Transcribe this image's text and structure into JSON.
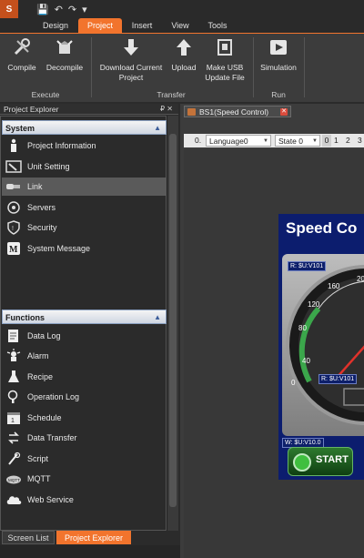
{
  "app": {
    "icon_letter": "S"
  },
  "quick_access": {
    "save": "💾",
    "undo": "↶",
    "redo": "↷",
    "more": "▾"
  },
  "ribbon_tabs": [
    {
      "label": "Design"
    },
    {
      "label": "Project"
    },
    {
      "label": "Insert"
    },
    {
      "label": "View"
    },
    {
      "label": "Tools"
    }
  ],
  "ribbon": {
    "compile": "Compile",
    "decompile": "Decompile",
    "group_execute": "Execute",
    "download_line1": "Download Current",
    "download_line2": "Project",
    "upload": "Upload",
    "make_usb_line1": "Make USB",
    "make_usb_line2": "Update File",
    "group_transfer": "Transfer",
    "simulation": "Simulation",
    "group_run": "Run"
  },
  "project_explorer": {
    "title": "Project Explorer",
    "pin": "₽ ✕",
    "system_header": "System",
    "system_items": [
      {
        "label": "Project Information"
      },
      {
        "label": "Unit Setting"
      },
      {
        "label": "Link"
      },
      {
        "label": "Servers"
      },
      {
        "label": "Security"
      },
      {
        "label": "System Message"
      }
    ],
    "functions_header": "Functions",
    "functions_items": [
      {
        "label": "Data Log"
      },
      {
        "label": "Alarm"
      },
      {
        "label": "Recipe"
      },
      {
        "label": "Operation Log"
      },
      {
        "label": "Schedule"
      },
      {
        "label": "Data Transfer"
      },
      {
        "label": "Script"
      },
      {
        "label": "MQTT"
      },
      {
        "label": "Web Service"
      }
    ]
  },
  "bottom_tabs": [
    {
      "label": "Screen List"
    },
    {
      "label": "Project Explorer"
    }
  ],
  "document": {
    "tab_label": "BS1(Speed Control)",
    "close": "✕",
    "toolbar": {
      "language_index": "0.",
      "language": "Language0",
      "state": "State 0",
      "s0": "0",
      "s1": "1",
      "s2": "2",
      "s3": "3"
    }
  },
  "screen": {
    "title": "Speed Co",
    "tag_top": "R: $U:V101",
    "tag_mid": "R: $U:V101",
    "tag_bottom": "W: $U:V10.0",
    "start_label": "START",
    "gauge_ticks": [
      "0",
      "40",
      "80",
      "120",
      "160",
      "20"
    ]
  },
  "colors": {
    "accent": "#f2742d",
    "screen_bg": "#0c1d6e"
  }
}
